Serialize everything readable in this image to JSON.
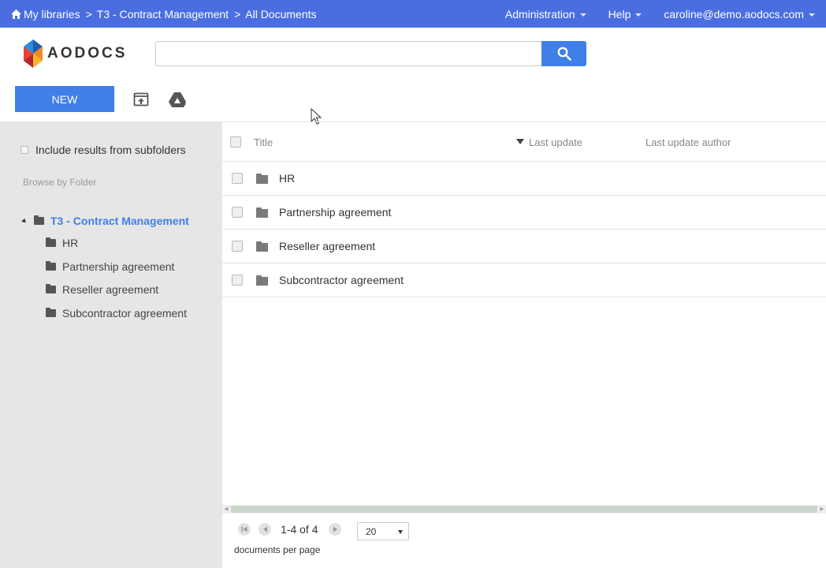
{
  "breadcrumb": [
    {
      "label": "My libraries"
    },
    {
      "label": "T3 - Contract Management"
    },
    {
      "label": "All Documents"
    }
  ],
  "breadcrumb_sep": ">",
  "topnav": {
    "administration": "Administration",
    "help": "Help",
    "user": "caroline@demo.aodocs.com"
  },
  "logo": {
    "text": "AODOCS"
  },
  "search": {
    "value": "",
    "placeholder": ""
  },
  "toolbar": {
    "new_label": "NEW"
  },
  "sidebar": {
    "include_subfolders": "Include results from subfolders",
    "browse_label": "Browse by Folder",
    "root": "T3 - Contract Management",
    "children": [
      "HR",
      "Partnership agreement",
      "Reseller agreement",
      "Subcontractor agreement"
    ]
  },
  "list": {
    "columns": {
      "title": "Title",
      "last_update": "Last update",
      "last_update_author": "Last update author"
    },
    "rows": [
      {
        "title": "HR"
      },
      {
        "title": "Partnership agreement"
      },
      {
        "title": "Reseller agreement"
      },
      {
        "title": "Subcontractor agreement"
      }
    ]
  },
  "pagination": {
    "range": "1-4 of 4",
    "page_size": "20",
    "per_page_label": "documents per page"
  },
  "colors": {
    "topbar": "#4a6ee0",
    "accent": "#3f7fe8",
    "sidebar": "#e6e6e6"
  }
}
